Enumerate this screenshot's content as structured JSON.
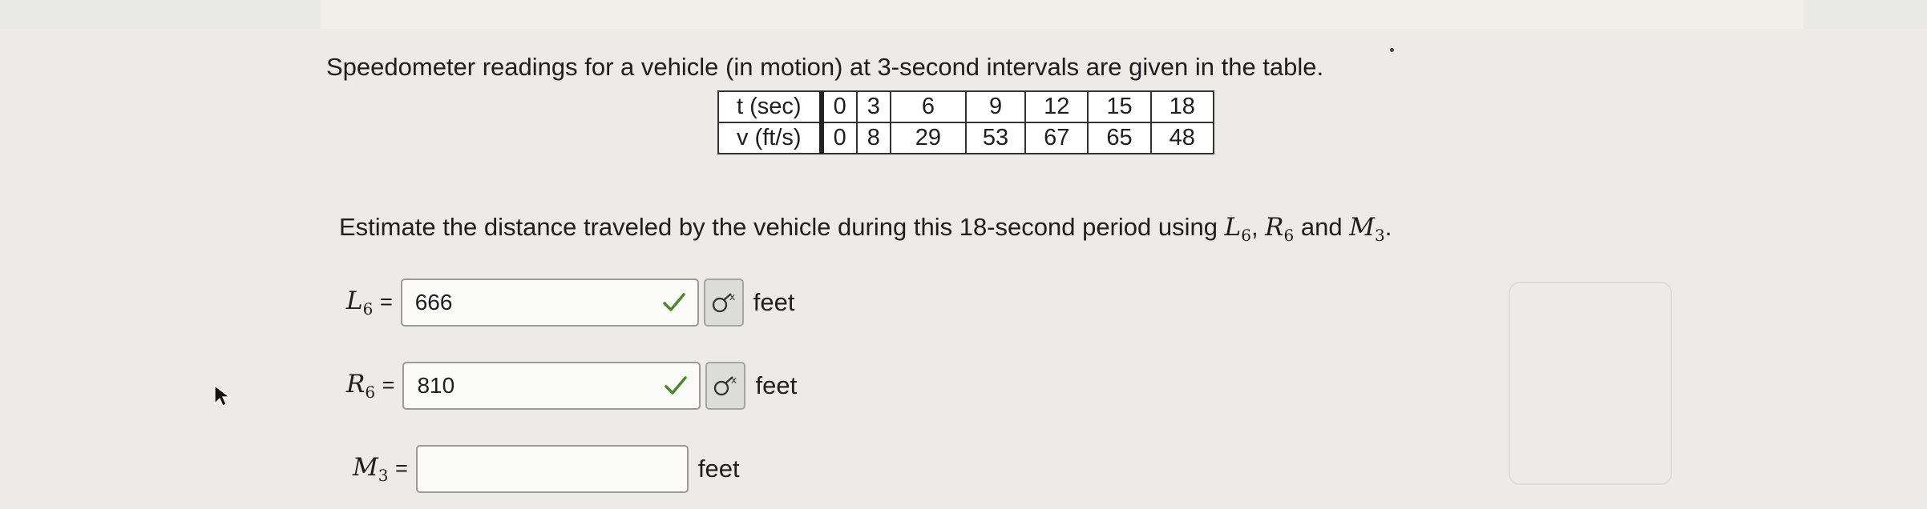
{
  "question": {
    "prompt": "Speedometer readings for a vehicle (in motion) at 3-second intervals are given in the table.",
    "estimate_text": "Estimate the distance traveled by the vehicle during this 18-second period using",
    "estimate_and": "and",
    "estimate_end": "."
  },
  "table": {
    "t_header": "t (sec)",
    "v_header": "v (ft/s)",
    "t_values": [
      "0",
      "3",
      "6",
      "9",
      "12",
      "15",
      "18"
    ],
    "v_values": [
      "0",
      "8",
      "29",
      "53",
      "67",
      "65",
      "48"
    ]
  },
  "answers": {
    "L6": {
      "var": "L",
      "sub": "6",
      "eq": "=",
      "value": "666",
      "unit": "feet",
      "status": "correct"
    },
    "R6": {
      "var": "R",
      "sub": "6",
      "eq": "=",
      "value": "810",
      "unit": "feet",
      "status": "correct"
    },
    "M3": {
      "var": "M",
      "sub": "3",
      "eq": "=",
      "value": "",
      "unit": "feet"
    }
  },
  "icons": {
    "check": "check-icon",
    "keypad": "math-keypad-icon",
    "cursor": "mouse-pointer-icon"
  },
  "colors": {
    "check": "#4a8a2c"
  }
}
